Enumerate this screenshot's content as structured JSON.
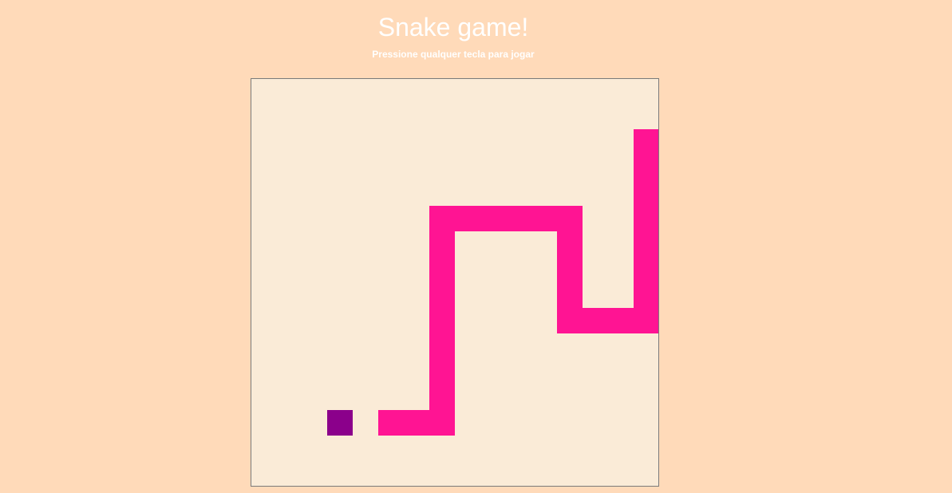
{
  "header": {
    "title": "Snake game!",
    "subtitle": "Pressione qualquer tecla para jogar"
  },
  "game": {
    "grid_columns": 16,
    "grid_rows": 16,
    "colors": {
      "page_background": "#FFDAB9",
      "board_background": "#FAEBD7",
      "board_border": "#7A7A7A",
      "snake": "#FF1493",
      "food": "#8B008B",
      "text": "#FFFFFF"
    },
    "food": {
      "col": 3,
      "row": 13
    },
    "snake": [
      {
        "col": 5,
        "row": 13
      },
      {
        "col": 6,
        "row": 13
      },
      {
        "col": 7,
        "row": 13
      },
      {
        "col": 7,
        "row": 12
      },
      {
        "col": 7,
        "row": 11
      },
      {
        "col": 7,
        "row": 10
      },
      {
        "col": 7,
        "row": 9
      },
      {
        "col": 7,
        "row": 8
      },
      {
        "col": 7,
        "row": 7
      },
      {
        "col": 7,
        "row": 6
      },
      {
        "col": 7,
        "row": 5
      },
      {
        "col": 8,
        "row": 5
      },
      {
        "col": 9,
        "row": 5
      },
      {
        "col": 10,
        "row": 5
      },
      {
        "col": 11,
        "row": 5
      },
      {
        "col": 12,
        "row": 5
      },
      {
        "col": 12,
        "row": 6
      },
      {
        "col": 12,
        "row": 7
      },
      {
        "col": 12,
        "row": 8
      },
      {
        "col": 12,
        "row": 9
      },
      {
        "col": 13,
        "row": 9
      },
      {
        "col": 14,
        "row": 9
      },
      {
        "col": 15,
        "row": 9
      },
      {
        "col": 15,
        "row": 8
      },
      {
        "col": 15,
        "row": 7
      },
      {
        "col": 15,
        "row": 6
      },
      {
        "col": 15,
        "row": 5
      },
      {
        "col": 15,
        "row": 4
      },
      {
        "col": 15,
        "row": 3
      },
      {
        "col": 15,
        "row": 2
      }
    ]
  }
}
